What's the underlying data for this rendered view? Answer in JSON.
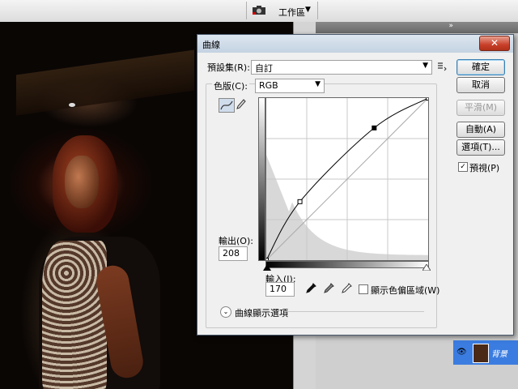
{
  "app": {
    "workspace_label": "工作區",
    "layer_name": "背景"
  },
  "dialog": {
    "title": "曲線",
    "preset_label": "預設集(R):",
    "preset_value": "自訂",
    "channel_label": "色版(C):",
    "channel_value": "RGB",
    "output_label": "輸出(O):",
    "output_value": "208",
    "input_label": "輸入(I):",
    "input_value": "170",
    "clipping_label": "顯示色偏區域(W)",
    "display_options_label": "曲線顯示選項",
    "buttons": {
      "ok": "確定",
      "cancel": "取消",
      "smooth": "平滑(M)",
      "auto": "自動(A)",
      "options": "選項(T)...",
      "preview": "預視(P)"
    },
    "preview_checked": true,
    "clipping_checked": false
  },
  "curve": {
    "points": [
      [
        0,
        0
      ],
      [
        53,
        92
      ],
      [
        170,
        208
      ],
      [
        255,
        255
      ]
    ],
    "selected_point": [
      170,
      208
    ],
    "range": [
      0,
      255
    ]
  },
  "colors": {
    "title_bar": "#c4d2e2",
    "close_button": "#c8402a",
    "layer_selected": "#3b7ce0"
  }
}
